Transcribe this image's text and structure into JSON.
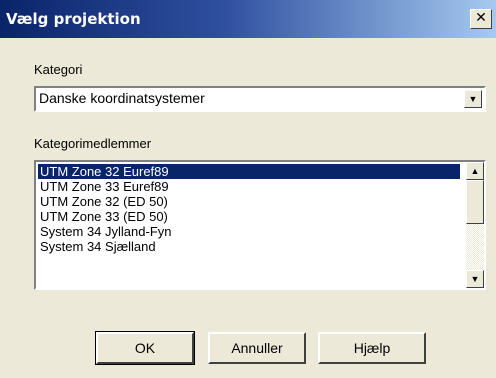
{
  "window": {
    "title": "Vælg projektion",
    "close_symbol": "✕"
  },
  "category": {
    "label": "Kategori",
    "selected_value": "Danske koordinatsystemer"
  },
  "members": {
    "label": "Kategorimedlemmer",
    "items": [
      "UTM Zone 32 Euref89",
      "UTM Zone 33 Euref89",
      "UTM Zone 32 (ED 50)",
      "UTM Zone 33 (ED 50)",
      "System 34 Jylland-Fyn",
      "System 34 Sjælland"
    ],
    "selected_index": 0
  },
  "buttons": {
    "ok": "OK",
    "cancel": "Annuller",
    "help": "Hjælp"
  },
  "icons": {
    "combo_arrow": "chevron-down-icon",
    "scroll_up": "scroll-up-icon",
    "scroll_down": "scroll-down-icon",
    "close": "close-icon"
  }
}
